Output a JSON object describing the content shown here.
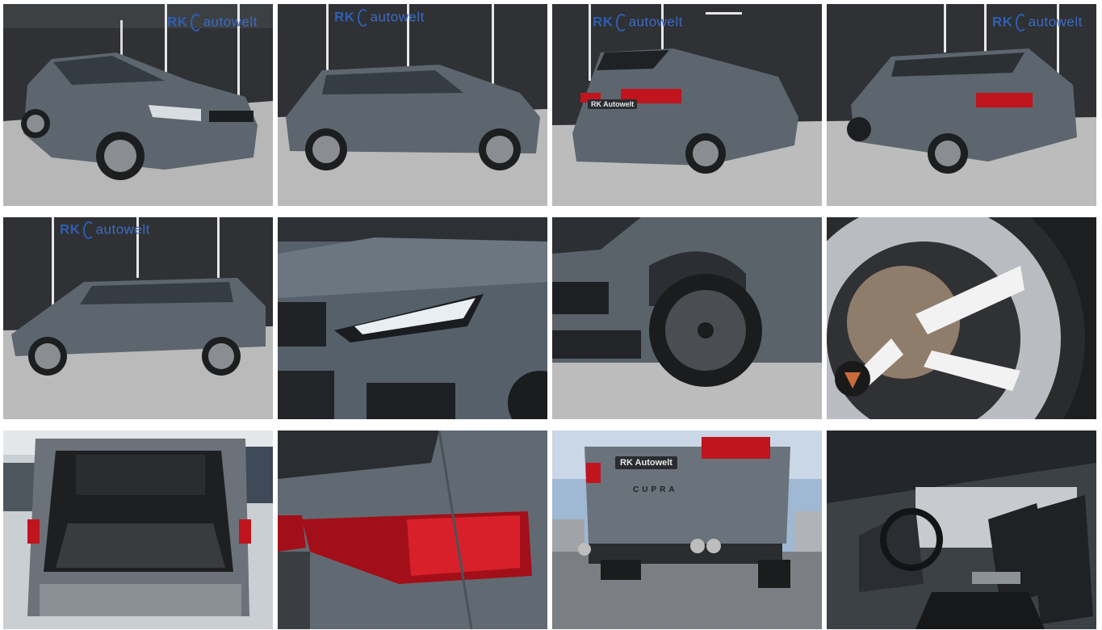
{
  "gallery": {
    "brand": {
      "prefix": "RK",
      "suffix": "autowelt"
    },
    "dealer_plate": "RK Autowelt",
    "model_badge": "CUPRA",
    "photos": [
      {
        "view": "front-three-quarter"
      },
      {
        "view": "side-right"
      },
      {
        "view": "rear-three-quarter-right"
      },
      {
        "view": "rear-three-quarter-left"
      },
      {
        "view": "side-left"
      },
      {
        "view": "headlight-detail"
      },
      {
        "view": "front-wheel-detail"
      },
      {
        "view": "wheel-brake-detail"
      },
      {
        "view": "open-trunk"
      },
      {
        "view": "taillight-detail"
      },
      {
        "view": "rear-exhaust-low-angle"
      },
      {
        "view": "interior-front-seats"
      }
    ]
  },
  "colors": {
    "car_body": "#5d666e",
    "showroom_wall": "#2b2d30",
    "floor": "#bdbdbd",
    "taillight": "#c0141e",
    "brand_blue": "#2f5fb3"
  }
}
